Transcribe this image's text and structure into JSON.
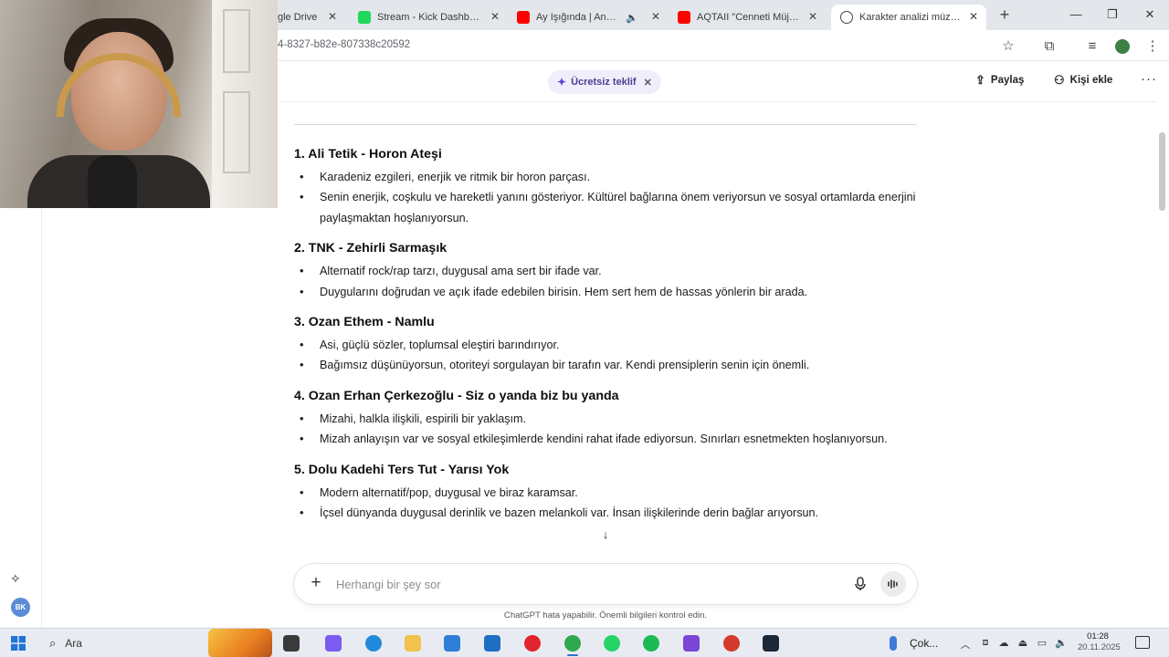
{
  "browser": {
    "tabs": [
      {
        "title": "Google Drive",
        "favicon_color": "#ffffff",
        "icon": "google-drive-icon"
      },
      {
        "title": "Stream - Kick Dashboard",
        "favicon_color": "#1fd85c",
        "icon": "kick-icon"
      },
      {
        "title": "Ay Işığında | Anatolia",
        "favicon_color": "#ff0000",
        "icon": "youtube-icon"
      },
      {
        "title": "AQTAII \"Cenneti Müjdel",
        "favicon_color": "#ff0000",
        "icon": "youtube-icon"
      },
      {
        "title": "Karakter analizi müziğe",
        "favicon_color": "#444444",
        "icon": "chatgpt-icon"
      }
    ],
    "tab_first_visible": "gle Drive",
    "url": "4-8327-b82e-807338c20592"
  },
  "header": {
    "offer_label": "Ücretsiz teklif",
    "share_label": "Paylaş",
    "add_person_label": "Kişi ekle"
  },
  "sidebar": {
    "avatar_initials": "BK"
  },
  "entries": [
    {
      "title": "1. Ali Tetik - Horon Ateşi",
      "bullets": [
        "Karadeniz ezgileri, enerjik ve ritmik bir horon parçası.",
        "Senin enerjik, coşkulu ve hareketli yanını gösteriyor. Kültürel bağlarına önem veriyorsun ve sosyal ortamlarda enerjini paylaşmaktan hoşlanıyorsun."
      ]
    },
    {
      "title": "2. TNK - Zehirli Sarmaşık",
      "bullets": [
        "Alternatif rock/rap tarzı, duygusal ama sert bir ifade var.",
        "Duygularını doğrudan ve açık ifade edebilen birisin. Hem sert hem de hassas yönlerin bir arada."
      ]
    },
    {
      "title": "3. Ozan Ethem - Namlu",
      "bullets": [
        "Asi, güçlü sözler, toplumsal eleştiri barındırıyor.",
        "Bağımsız düşünüyorsun, otoriteyi sorgulayan bir tarafın var. Kendi prensiplerin senin için önemli."
      ]
    },
    {
      "title": "4. Ozan Erhan Çerkezoğlu - Siz o yanda biz bu yanda",
      "bullets": [
        "Mizahi, halkla ilişkili, espirili bir yaklaşım.",
        "Mizah anlayışın var ve sosyal etkileşimlerde kendini rahat ifade ediyorsun. Sınırları esnetmekten hoşlanıyorsun."
      ]
    },
    {
      "title": "5. Dolu Kadehi Ters Tut - Yarısı Yok",
      "bullets": [
        "Modern alternatif/pop, duygusal ve biraz karamsar.",
        "İçsel dünyanda duygusal derinlik ve bazen melankoli var. İnsan ilişkilerinde derin bağlar arıyorsun."
      ]
    }
  ],
  "composer": {
    "placeholder": "Herhangi bir şey sor",
    "disclaimer": "ChatGPT hata yapabilir. Önemli bilgileri kontrol edin."
  },
  "taskbar": {
    "search_label": "Ara",
    "weather_text": "Çok...",
    "time": "01:28",
    "date": "20.11.2025",
    "accent": "#2f6fd6",
    "apps": [
      {
        "name": "task-view-icon",
        "color": "#3a3a3a"
      },
      {
        "name": "copilot-icon",
        "color": "#7a5cf0"
      },
      {
        "name": "edge-icon",
        "color": "#1f8ad9"
      },
      {
        "name": "file-explorer-icon",
        "color": "#f2c14e"
      },
      {
        "name": "store-icon",
        "color": "#2d7fd8"
      },
      {
        "name": "mail-icon",
        "color": "#1e6fc2"
      },
      {
        "name": "opera-icon",
        "color": "#e2242c"
      },
      {
        "name": "chrome-icon",
        "color": "#2fa84f"
      },
      {
        "name": "whatsapp-icon",
        "color": "#25d366"
      },
      {
        "name": "spotify-icon",
        "color": "#1db954"
      },
      {
        "name": "streaming-app-icon",
        "color": "#7b45d6"
      },
      {
        "name": "speedometer-icon",
        "color": "#d33a2c"
      },
      {
        "name": "steam-icon",
        "color": "#1b2838"
      }
    ]
  }
}
